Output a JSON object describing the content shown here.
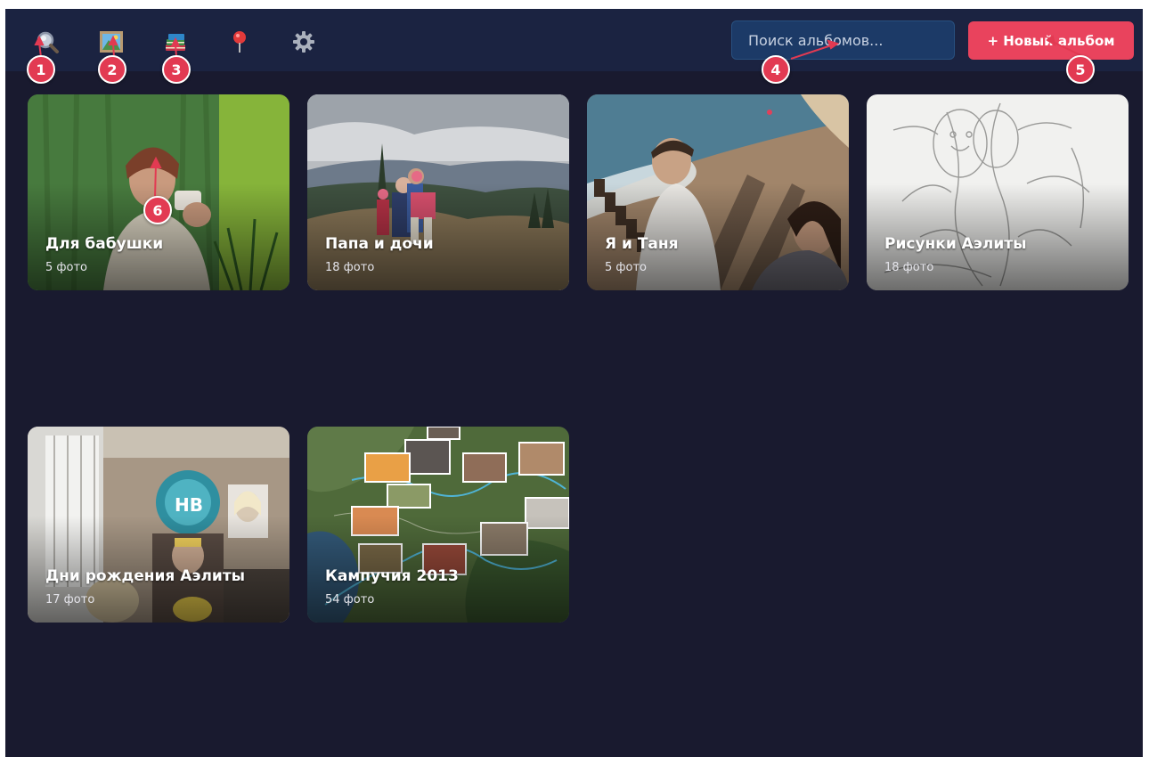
{
  "toolbar": {
    "nav_icons": [
      "search-icon",
      "gallery-icon",
      "albums-icon",
      "map-pin-icon",
      "gear-icon"
    ],
    "search_placeholder": "Поиск альбомов...",
    "new_album_label": "+ Новый альбом"
  },
  "albums": [
    {
      "title": "Для бабушки",
      "count": "5 фото"
    },
    {
      "title": "Папа и дочи",
      "count": "18 фото"
    },
    {
      "title": "Я и Таня",
      "count": "5 фото"
    },
    {
      "title": "Рисунки Аэлиты",
      "count": "18 фото"
    },
    {
      "title": "Дни рождения Аэлиты",
      "count": "17 фото"
    },
    {
      "title": "Кампучия 2013",
      "count": "54 фото"
    }
  ],
  "annotations": [
    "1",
    "2",
    "3",
    "4",
    "5",
    "6"
  ],
  "colors": {
    "background": "#191a2f",
    "topbar": "#1b2341",
    "search_bg": "#1c3a67",
    "accent": "#e9435d",
    "marker": "#e23a52"
  }
}
